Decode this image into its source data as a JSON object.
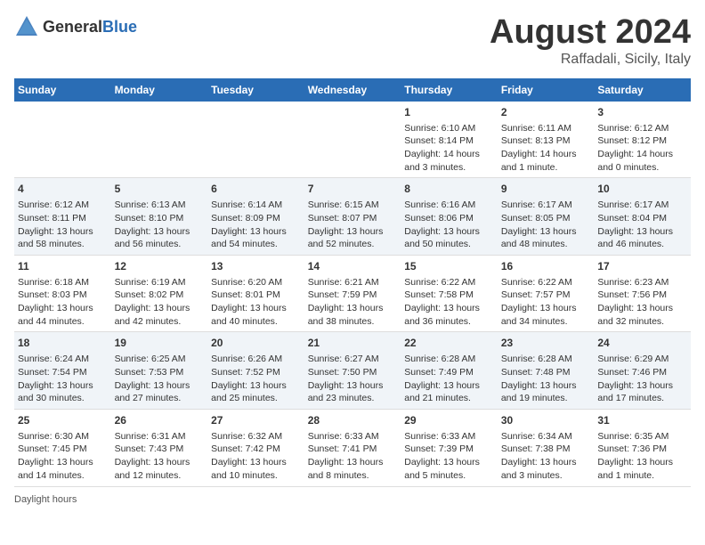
{
  "header": {
    "logo_general": "General",
    "logo_blue": "Blue",
    "main_title": "August 2024",
    "subtitle": "Raffadali, Sicily, Italy"
  },
  "calendar": {
    "days_of_week": [
      "Sunday",
      "Monday",
      "Tuesday",
      "Wednesday",
      "Thursday",
      "Friday",
      "Saturday"
    ],
    "weeks": [
      {
        "days": [
          {
            "number": "",
            "content": ""
          },
          {
            "number": "",
            "content": ""
          },
          {
            "number": "",
            "content": ""
          },
          {
            "number": "",
            "content": ""
          },
          {
            "number": "1",
            "content": "Sunrise: 6:10 AM\nSunset: 8:14 PM\nDaylight: 14 hours\nand 3 minutes."
          },
          {
            "number": "2",
            "content": "Sunrise: 6:11 AM\nSunset: 8:13 PM\nDaylight: 14 hours\nand 1 minute."
          },
          {
            "number": "3",
            "content": "Sunrise: 6:12 AM\nSunset: 8:12 PM\nDaylight: 14 hours\nand 0 minutes."
          }
        ]
      },
      {
        "days": [
          {
            "number": "4",
            "content": "Sunrise: 6:12 AM\nSunset: 8:11 PM\nDaylight: 13 hours\nand 58 minutes."
          },
          {
            "number": "5",
            "content": "Sunrise: 6:13 AM\nSunset: 8:10 PM\nDaylight: 13 hours\nand 56 minutes."
          },
          {
            "number": "6",
            "content": "Sunrise: 6:14 AM\nSunset: 8:09 PM\nDaylight: 13 hours\nand 54 minutes."
          },
          {
            "number": "7",
            "content": "Sunrise: 6:15 AM\nSunset: 8:07 PM\nDaylight: 13 hours\nand 52 minutes."
          },
          {
            "number": "8",
            "content": "Sunrise: 6:16 AM\nSunset: 8:06 PM\nDaylight: 13 hours\nand 50 minutes."
          },
          {
            "number": "9",
            "content": "Sunrise: 6:17 AM\nSunset: 8:05 PM\nDaylight: 13 hours\nand 48 minutes."
          },
          {
            "number": "10",
            "content": "Sunrise: 6:17 AM\nSunset: 8:04 PM\nDaylight: 13 hours\nand 46 minutes."
          }
        ]
      },
      {
        "days": [
          {
            "number": "11",
            "content": "Sunrise: 6:18 AM\nSunset: 8:03 PM\nDaylight: 13 hours\nand 44 minutes."
          },
          {
            "number": "12",
            "content": "Sunrise: 6:19 AM\nSunset: 8:02 PM\nDaylight: 13 hours\nand 42 minutes."
          },
          {
            "number": "13",
            "content": "Sunrise: 6:20 AM\nSunset: 8:01 PM\nDaylight: 13 hours\nand 40 minutes."
          },
          {
            "number": "14",
            "content": "Sunrise: 6:21 AM\nSunset: 7:59 PM\nDaylight: 13 hours\nand 38 minutes."
          },
          {
            "number": "15",
            "content": "Sunrise: 6:22 AM\nSunset: 7:58 PM\nDaylight: 13 hours\nand 36 minutes."
          },
          {
            "number": "16",
            "content": "Sunrise: 6:22 AM\nSunset: 7:57 PM\nDaylight: 13 hours\nand 34 minutes."
          },
          {
            "number": "17",
            "content": "Sunrise: 6:23 AM\nSunset: 7:56 PM\nDaylight: 13 hours\nand 32 minutes."
          }
        ]
      },
      {
        "days": [
          {
            "number": "18",
            "content": "Sunrise: 6:24 AM\nSunset: 7:54 PM\nDaylight: 13 hours\nand 30 minutes."
          },
          {
            "number": "19",
            "content": "Sunrise: 6:25 AM\nSunset: 7:53 PM\nDaylight: 13 hours\nand 27 minutes."
          },
          {
            "number": "20",
            "content": "Sunrise: 6:26 AM\nSunset: 7:52 PM\nDaylight: 13 hours\nand 25 minutes."
          },
          {
            "number": "21",
            "content": "Sunrise: 6:27 AM\nSunset: 7:50 PM\nDaylight: 13 hours\nand 23 minutes."
          },
          {
            "number": "22",
            "content": "Sunrise: 6:28 AM\nSunset: 7:49 PM\nDaylight: 13 hours\nand 21 minutes."
          },
          {
            "number": "23",
            "content": "Sunrise: 6:28 AM\nSunset: 7:48 PM\nDaylight: 13 hours\nand 19 minutes."
          },
          {
            "number": "24",
            "content": "Sunrise: 6:29 AM\nSunset: 7:46 PM\nDaylight: 13 hours\nand 17 minutes."
          }
        ]
      },
      {
        "days": [
          {
            "number": "25",
            "content": "Sunrise: 6:30 AM\nSunset: 7:45 PM\nDaylight: 13 hours\nand 14 minutes."
          },
          {
            "number": "26",
            "content": "Sunrise: 6:31 AM\nSunset: 7:43 PM\nDaylight: 13 hours\nand 12 minutes."
          },
          {
            "number": "27",
            "content": "Sunrise: 6:32 AM\nSunset: 7:42 PM\nDaylight: 13 hours\nand 10 minutes."
          },
          {
            "number": "28",
            "content": "Sunrise: 6:33 AM\nSunset: 7:41 PM\nDaylight: 13 hours\nand 8 minutes."
          },
          {
            "number": "29",
            "content": "Sunrise: 6:33 AM\nSunset: 7:39 PM\nDaylight: 13 hours\nand 5 minutes."
          },
          {
            "number": "30",
            "content": "Sunrise: 6:34 AM\nSunset: 7:38 PM\nDaylight: 13 hours\nand 3 minutes."
          },
          {
            "number": "31",
            "content": "Sunrise: 6:35 AM\nSunset: 7:36 PM\nDaylight: 13 hours\nand 1 minute."
          }
        ]
      }
    ]
  },
  "footer": {
    "note": "Daylight hours"
  }
}
